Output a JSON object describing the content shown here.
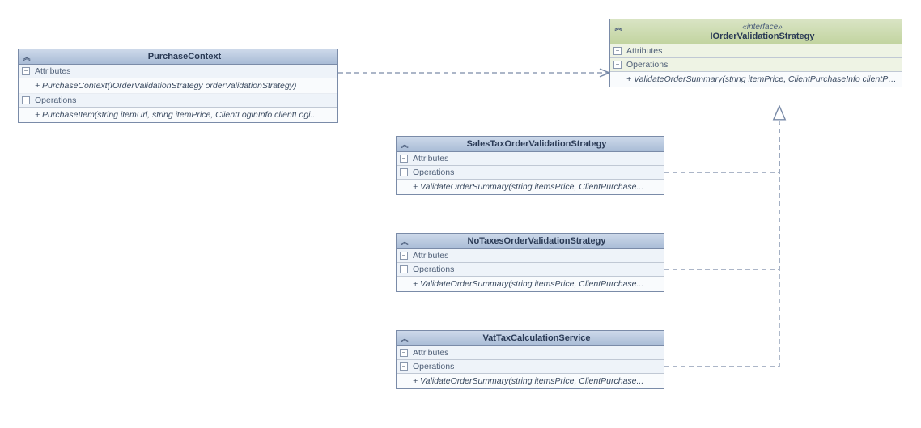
{
  "classes": {
    "purchaseContext": {
      "name": "PurchaseContext",
      "attributesLabel": "Attributes",
      "operationsLabel": "Operations",
      "attrs": [
        "+ PurchaseContext(IOrderValidationStrategy orderValidationStrategy)"
      ],
      "ops": [
        "+ PurchaseItem(string itemUrl, string itemPrice, ClientLoginInfo clientLogi..."
      ]
    },
    "iOrderValidationStrategy": {
      "stereotype": "«interface»",
      "name": "IOrderValidationStrategy",
      "attributesLabel": "Attributes",
      "operationsLabel": "Operations",
      "ops": [
        "+ ValidateOrderSummary(string itemPrice, ClientPurchaseInfo clientPurch..."
      ]
    },
    "salesTax": {
      "name": "SalesTaxOrderValidationStrategy",
      "attributesLabel": "Attributes",
      "operationsLabel": "Operations",
      "ops": [
        "+ ValidateOrderSummary(string itemsPrice, ClientPurchase..."
      ]
    },
    "noTaxes": {
      "name": "NoTaxesOrderValidationStrategy",
      "attributesLabel": "Attributes",
      "operationsLabel": "Operations",
      "ops": [
        "+ ValidateOrderSummary(string itemsPrice, ClientPurchase..."
      ]
    },
    "vatTax": {
      "name": "VatTaxCalculationService",
      "attributesLabel": "Attributes",
      "operationsLabel": "Operations",
      "ops": [
        "+ ValidateOrderSummary(string  itemsPrice, ClientPurchase..."
      ]
    }
  }
}
